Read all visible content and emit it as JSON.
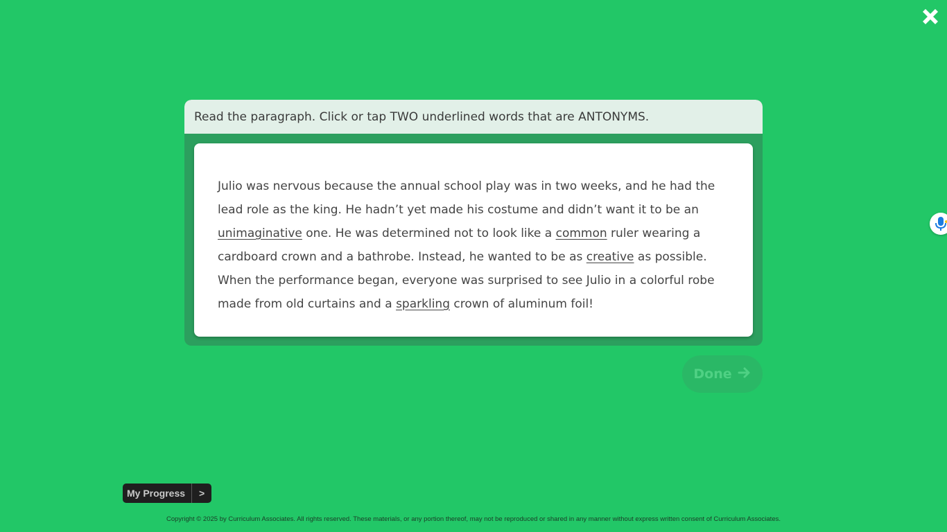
{
  "colors": {
    "background": "#22c767",
    "card_frame": "#2c9f5e",
    "prompt_bar": "#e2f0e8",
    "done_button": "#2ab866"
  },
  "header": {
    "close_icon": "close-x-icon"
  },
  "prompt": {
    "text": "Read the paragraph. Click or tap TWO underlined words that are ANTONYMS."
  },
  "passage": {
    "segments": [
      {
        "text": "Julio was nervous because the annual school play was in two weeks, and he had the lead role as the king. He hadn’t yet made his costume and didn’t want it to be an ",
        "choice": false
      },
      {
        "text": "unimaginative",
        "choice": true
      },
      {
        "text": " one. He was determined not to look like a ",
        "choice": false
      },
      {
        "text": "common",
        "choice": true
      },
      {
        "text": " ruler wearing a cardboard crown and a bathrobe. Instead, he wanted to be as ",
        "choice": false
      },
      {
        "text": "creative",
        "choice": true
      },
      {
        "text": " as possible. When the performance began, everyone was surprised to see Julio in a colorful robe made from old curtains and a ",
        "choice": false
      },
      {
        "text": "sparkling",
        "choice": true
      },
      {
        "text": " crown of aluminum foil!",
        "choice": false
      }
    ]
  },
  "done_button": {
    "label": "Done",
    "icon": "arrow-right-icon"
  },
  "microphone": {
    "icon": "microphone-icon"
  },
  "progress": {
    "label": "My Progress",
    "arrow": ">"
  },
  "footer": {
    "copyright": "Copyright © 2025 by Curriculum Associates. All rights reserved. These materials, or any portion thereof, may not be reproduced or shared in any manner without express written consent of Curriculum Associates."
  }
}
